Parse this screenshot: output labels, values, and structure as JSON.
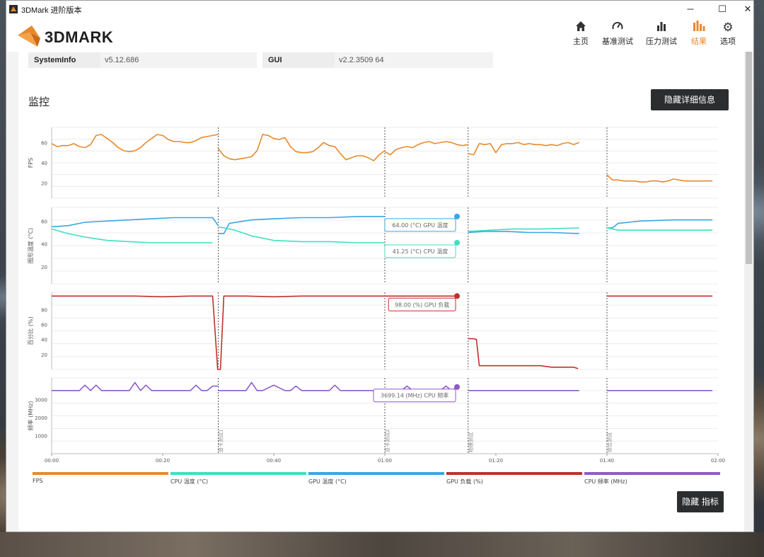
{
  "window": {
    "title": "3DMark 进阶版本",
    "minimize": "─",
    "maximize": "☐",
    "close": "✕"
  },
  "app": {
    "logo_text": "3DMARK"
  },
  "nav": [
    {
      "label": "主页",
      "icon": "home-icon",
      "glyph": "⌂"
    },
    {
      "label": "基准测试",
      "icon": "speedometer-icon",
      "glyph": "◔"
    },
    {
      "label": "压力测试",
      "icon": "bars-icon",
      "glyph": "▮"
    },
    {
      "label": "结果",
      "icon": "results-icon",
      "glyph": "▮"
    },
    {
      "label": "选项",
      "icon": "gear-icon",
      "glyph": "⚙"
    }
  ],
  "info": {
    "systeminfo_key": "SystemInfo",
    "systeminfo_val": "v5.12.686",
    "gui_key": "GUI",
    "gui_val": "v2.2.3509 64"
  },
  "monitor": {
    "title": "监控",
    "hide_details_button": "隐藏详细信息",
    "hide_metrics_button": "隐藏 指标"
  },
  "colors": {
    "fps": "#e8892b",
    "cpu_temp": "#3ee0c0",
    "gpu_temp": "#3aa6e3",
    "gpu_load": "#c0302b",
    "cpu_freq": "#8e5bc8",
    "accent": "#e8892b"
  },
  "chart_data": {
    "type": "line",
    "x_unit": "time",
    "x_ticks": [
      "00:00",
      "00:20",
      "00:40",
      "01:00",
      "01:20",
      "01:40",
      "02:00"
    ],
    "xlim_seconds": [
      0,
      120
    ],
    "markers": [
      {
        "t": 30,
        "label": "显卡测试1"
      },
      {
        "t": 60,
        "label": "显卡测试2"
      },
      {
        "t": 75,
        "label": "物理测试"
      },
      {
        "t": 100,
        "label": "综合测试"
      }
    ],
    "panels": [
      {
        "ylabel": "FPS",
        "yticks": [
          20,
          40,
          60
        ],
        "ylim": [
          5,
          75
        ],
        "series": [
          {
            "key": "fps",
            "name": "FPS",
            "segments": [
              {
                "t": [
                  0,
                  1,
                  2,
                  3,
                  4,
                  5,
                  6,
                  7,
                  8,
                  9,
                  10,
                  11,
                  12,
                  13,
                  14,
                  15,
                  16,
                  17,
                  18,
                  19,
                  20,
                  21,
                  22,
                  23,
                  24,
                  25,
                  26,
                  27,
                  28,
                  29,
                  30
                ],
                "v": [
                  59,
                  56,
                  57,
                  57,
                  59,
                  56,
                  55,
                  58,
                  67,
                  68,
                  64,
                  60,
                  55,
                  52,
                  51,
                  52,
                  55,
                  60,
                  64,
                  68,
                  67,
                  63,
                  61,
                  61,
                  60,
                  60,
                  62,
                  65,
                  66,
                  67,
                  68
                ]
              },
              {
                "t": [
                  30,
                  31,
                  32,
                  33,
                  34,
                  35,
                  36,
                  37,
                  38,
                  39,
                  40,
                  41,
                  42,
                  43,
                  44,
                  45,
                  46,
                  47,
                  48,
                  49,
                  50,
                  51,
                  52,
                  53,
                  54,
                  55,
                  56,
                  57,
                  58,
                  59,
                  60
                ],
                "v": [
                  54,
                  47,
                  44,
                  43,
                  44,
                  45,
                  46,
                  52,
                  68,
                  67,
                  64,
                  63,
                  65,
                  56,
                  51,
                  50,
                  50,
                  51,
                  55,
                  60,
                  57,
                  56,
                  49,
                  43,
                  45,
                  47,
                  47,
                  45,
                  42,
                  48,
                  52
                ]
              },
              {
                "t": [
                  60,
                  61,
                  62,
                  63,
                  64,
                  65,
                  66,
                  67,
                  68,
                  69,
                  70,
                  71,
                  72,
                  73,
                  74,
                  75
                ],
                "v": [
                  51,
                  48,
                  53,
                  55,
                  56,
                  55,
                  58,
                  60,
                  61,
                  59,
                  60,
                  61,
                  60,
                  58,
                  57,
                  58
                ]
              },
              {
                "t": [
                  75,
                  76,
                  77,
                  78,
                  79,
                  80,
                  81,
                  82,
                  83,
                  84,
                  85,
                  86,
                  87,
                  88,
                  89,
                  90,
                  91,
                  92,
                  93,
                  94,
                  95
                ],
                "v": [
                  49,
                  48,
                  59,
                  58,
                  59,
                  50,
                  58,
                  59,
                  59,
                  60,
                  58,
                  59,
                  58,
                  58,
                  57,
                  58,
                  57,
                  59,
                  60,
                  58,
                  60
                ]
              },
              {
                "t": [
                  100,
                  101,
                  102,
                  103,
                  104,
                  105,
                  106,
                  107,
                  108,
                  109,
                  110,
                  111,
                  112,
                  113,
                  114,
                  115,
                  116,
                  117,
                  118,
                  119
                ],
                "v": [
                  28,
                  23,
                  23,
                  22,
                  22,
                  22,
                  21,
                  21,
                  22,
                  22,
                  21,
                  22,
                  24,
                  23,
                  22,
                  22,
                  22,
                  22,
                  22,
                  22
                ]
              }
            ]
          }
        ]
      },
      {
        "ylabel": "图形温度 (°C)",
        "yticks": [
          20,
          40,
          60
        ],
        "ylim": [
          5,
          72
        ],
        "series": [
          {
            "key": "gpu_temp",
            "name": "GPU 温度 (°C)",
            "segments": [
              {
                "t": [
                  0,
                  3,
                  6,
                  10,
                  14,
                  18,
                  22,
                  26,
                  29,
                  30
                ],
                "v": [
                  55,
                  56,
                  59,
                  60,
                  61,
                  62,
                  63,
                  63,
                  63,
                  56
                ]
              },
              {
                "t": [
                  30,
                  31,
                  32,
                  36,
                  40,
                  45,
                  50,
                  55,
                  60
                ],
                "v": [
                  49,
                  49,
                  58,
                  61,
                  62,
                  63,
                  63,
                  64,
                  64
                ]
              },
              {
                "t": [
                  75,
                  78,
                  82,
                  86,
                  90,
                  95
                ],
                "v": [
                  50,
                  51,
                  51,
                  50,
                  50,
                  49
                ]
              },
              {
                "t": [
                  100,
                  101,
                  102,
                  106,
                  112,
                  119
                ],
                "v": [
                  54,
                  54,
                  58,
                  60,
                  61,
                  61
                ]
              }
            ]
          },
          {
            "key": "cpu_temp",
            "name": "CPU 温度 (°C)",
            "segments": [
              {
                "t": [
                  0,
                  3,
                  6,
                  10,
                  14,
                  18,
                  22,
                  26,
                  29
                ],
                "v": [
                  53,
                  49,
                  46,
                  43,
                  42,
                  41,
                  41,
                  41,
                  41
                ]
              },
              {
                "t": [
                  30,
                  33,
                  36,
                  40,
                  45,
                  50,
                  55,
                  60
                ],
                "v": [
                  55,
                  52,
                  47,
                  43,
                  42,
                  42,
                  41,
                  41
                ]
              },
              {
                "t": [
                  75,
                  79,
                  83,
                  88,
                  95
                ],
                "v": [
                  51,
                  52,
                  53,
                  53,
                  54
                ]
              },
              {
                "t": [
                  100,
                  102,
                  106,
                  112,
                  119
                ],
                "v": [
                  54,
                  52,
                  52,
                  52,
                  52
                ]
              }
            ]
          }
        ],
        "tooltips": [
          {
            "key": "gpu_temp",
            "text": "64.00 (°C) GPU 温度",
            "t": 73,
            "v": 64
          },
          {
            "key": "cpu_temp",
            "text": "41.25 (°C) CPU 温度",
            "t": 73,
            "v": 41
          }
        ]
      },
      {
        "ylabel": "百分比 (%)",
        "yticks": [
          20,
          40,
          60,
          80
        ],
        "ylim": [
          0,
          103
        ],
        "series": [
          {
            "key": "gpu_load",
            "name": "GPU 负载 (%)",
            "segments": [
              {
                "t": [
                  0,
                  5,
                  10,
                  15,
                  20,
                  25,
                  28,
                  29,
                  29.9,
                  30.4,
                  31,
                  35,
                  40,
                  45,
                  50,
                  55,
                  60,
                  73
                ],
                "v": [
                  98,
                  98,
                  98,
                  98,
                  97,
                  98,
                  98,
                  98,
                  0,
                  0,
                  98,
                  98,
                  97,
                  98,
                  98,
                  98,
                  98,
                  98
                ]
              },
              {
                "t": [
                  75,
                  76,
                  76.5,
                  77,
                  80,
                  85,
                  88,
                  90,
                  94,
                  94.8
                ],
                "v": [
                  41,
                  41,
                  40,
                  5,
                  5,
                  5,
                  5,
                  3,
                  3,
                  1
                ]
              },
              {
                "t": [
                  100,
                  105,
                  110,
                  119
                ],
                "v": [
                  98,
                  98,
                  98,
                  98
                ]
              }
            ]
          }
        ],
        "tooltips": [
          {
            "key": "gpu_load",
            "text": "98.00 (%) GPU 负载",
            "t": 73,
            "v": 98
          }
        ]
      },
      {
        "ylabel": "频率 (MHz)",
        "yticks": [
          1000,
          2000,
          3000
        ],
        "ylim": [
          0,
          4200
        ],
        "series": [
          {
            "key": "cpu_freq",
            "name": "CPU 频率 (MHz)",
            "segments": [
              {
                "t": [
                  0,
                  5,
                  6,
                  7,
                  8,
                  9,
                  10,
                  14,
                  15,
                  16,
                  17,
                  18,
                  22,
                  25,
                  26,
                  27,
                  28,
                  29,
                  30
                ],
                "v": [
                  3500,
                  3500,
                  3800,
                  3500,
                  3800,
                  3500,
                  3500,
                  3500,
                  3950,
                  3500,
                  3800,
                  3500,
                  3500,
                  3500,
                  3800,
                  3500,
                  3500,
                  3750,
                  3750
                ]
              },
              {
                "t": [
                  30,
                  35,
                  36,
                  37,
                  38,
                  40,
                  42,
                  43,
                  44,
                  45,
                  50,
                  51,
                  52,
                  60,
                  63,
                  64,
                  65,
                  70,
                  71,
                  72,
                  73
                ],
                "v": [
                  3500,
                  3500,
                  3950,
                  3500,
                  3500,
                  3800,
                  3500,
                  3500,
                  3750,
                  3500,
                  3500,
                  3800,
                  3500,
                  3500,
                  3500,
                  3750,
                  3500,
                  3500,
                  3750,
                  3500,
                  3700
                ]
              },
              {
                "t": [
                  75,
                  95
                ],
                "v": [
                  3500,
                  3500
                ]
              },
              {
                "t": [
                  100,
                  119
                ],
                "v": [
                  3500,
                  3500
                ]
              }
            ]
          }
        ],
        "tooltips": [
          {
            "key": "cpu_freq",
            "text": "3699.14 (MHz) CPU 频率",
            "t": 73,
            "v": 3700
          }
        ]
      }
    ],
    "legend": [
      {
        "key": "fps",
        "label": "FPS"
      },
      {
        "key": "cpu_temp",
        "label": "CPU 温度 (°C)"
      },
      {
        "key": "gpu_temp",
        "label": "GPU 温度 (°C)"
      },
      {
        "key": "gpu_load",
        "label": "GPU 负载 (%)"
      },
      {
        "key": "cpu_freq",
        "label": "CPU 频率 (MHz)"
      }
    ]
  }
}
